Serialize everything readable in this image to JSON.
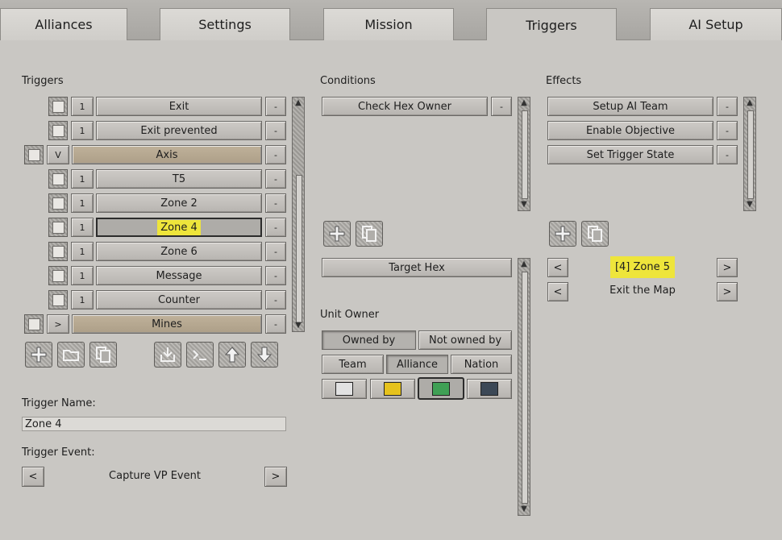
{
  "tabs": [
    {
      "label": "Alliances"
    },
    {
      "label": "Settings"
    },
    {
      "label": "Mission"
    },
    {
      "label": "Triggers"
    },
    {
      "label": "AI Setup"
    }
  ],
  "triggers": {
    "label": "Triggers",
    "items": [
      {
        "count": "1",
        "name": "Exit"
      },
      {
        "count": "1",
        "name": "Exit  prevented"
      },
      {
        "count": "V",
        "name": "Axis"
      },
      {
        "count": "1",
        "name": "T5"
      },
      {
        "count": "1",
        "name": "Zone 2"
      },
      {
        "count": "1",
        "name": "Zone 4"
      },
      {
        "count": "1",
        "name": "Zone 6"
      },
      {
        "count": "1",
        "name": "Message"
      },
      {
        "count": "1",
        "name": "Counter"
      },
      {
        "count": ">",
        "name": "Mines"
      }
    ],
    "remove_label": "-",
    "name_label": "Trigger Name:",
    "name_value": "Zone 4",
    "event_label": "Trigger Event:",
    "event_value": "Capture VP Event",
    "prev": "<",
    "next": ">"
  },
  "conditions": {
    "label": "Conditions",
    "items": [
      {
        "name": "Check Hex Owner"
      }
    ],
    "remove_label": "-",
    "detail_button": "Target Hex",
    "unit_owner_label": "Unit Owner",
    "owned_by": "Owned by",
    "not_owned_by": "Not owned by",
    "team": "Team",
    "alliance": "Alliance",
    "nation": "Nation",
    "colors": [
      "#e2e2e2",
      "#e6c21c",
      "#3fa055",
      "#3c4856"
    ]
  },
  "effects": {
    "label": "Effects",
    "items": [
      {
        "name": "Setup AI Team"
      },
      {
        "name": "Enable Objective"
      },
      {
        "name": "Set Trigger State"
      }
    ],
    "remove_label": "-",
    "sel1": "[4] Zone 5",
    "sel2": "Exit the Map",
    "prev": "<",
    "next": ">"
  }
}
